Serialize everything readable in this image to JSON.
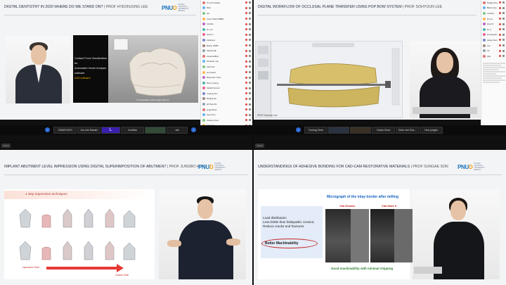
{
  "q1": {
    "title": "DIGITAL DENTISTRY IN 2020 WHERE DO WE STAND ON?",
    "prof": "| PROF HYEONJUNG LEE",
    "video_text": [
      "Contact Force Visualization for",
      "Automated Vector Analysis",
      "software",
      "ASA software"
    ],
    "video_caption": "In Cooperation with Imagen Mo Co.",
    "participants": [
      "7826871870",
      "Jun-ichi Sasaki",
      "L",
      "Amritha",
      "",
      "ofa"
    ],
    "chat_users": [
      "Jun-ichi Sasaki",
      "iPad",
      "ofa",
      "Kunio Tahan MBBS",
      "Amritha",
      "Dr. Lim",
      "HA Kim",
      "Fabieleus",
      "Bodou 35056",
      "Sebell Falk",
      "Amelie Eilbert",
      "Kimberlin Joe",
      "CHG Kim",
      "pou bassit",
      "Mokonson Chen",
      "Rami Lorieng",
      "Sebell Kamouc",
      "Youjung Kim",
      "Mingha bia",
      "Eli Tane Mo",
      "jungyi Brow",
      "Seoul Tan",
      "Suhang Chen",
      "Carmela",
      "YIlen Jun",
      "asa"
    ]
  },
  "q2": {
    "title": "DIGITAL WORKFLOW OF OCCLUSAL PLANE TRANSFER USING POP BOW SYSTEM",
    "prof": "| PROF SOHYOUN LEE",
    "video_caption": "PROF Sohyoun Lee",
    "participants": [
      "Yuming Chen",
      "",
      "",
      "Yohan Choe",
      "Chen wei Cha...",
      "Hur! jungbo"
    ],
    "chat_users": [
      "Mingjiu Ding",
      "Bianco lipo",
      "Amritha",
      "Dr.Lim",
      "lang 15",
      "Dr. A",
      "kumeleoal Hesti",
      "parag chemb",
      "ooh",
      "Aa",
      "Abd"
    ]
  },
  "q3": {
    "title": "IMPLANT ABUTMENT LEVEL IMPRESSION USING DIGITAL SUPERIMPOSITION OF ABUTMENT",
    "prof": "| PROF JUNGBO HUH",
    "slide_heading": "1 step Impression techniques",
    "left_label": "Impression Shell",
    "right_label": "Custom Shell",
    "top_status": "1 in 1"
  },
  "q4": {
    "title": "UNDERSTANDINGS OF ADHESIVE BONDING FOR CAD-CAM RESTORATIVE MATERIALS",
    "prof": "| PROF SUNGAE SON",
    "bullets": [
      "Load distribution",
      "Less brittle than feldspathic ceramic",
      "Reduce cracks and fractures"
    ],
    "highlight": "Better Machinability",
    "micro_title": "Micrograph of the inlay border after milling",
    "img1_label": "Vita Enamic",
    "img2_label": "Vita Mark II",
    "bottom_caption": "Good machinability with minimal chipping",
    "top_status": "1 in 1"
  },
  "logo": {
    "mark": "PNUD",
    "sub": "PUSAN NATIONAL UNIVERSITY DENTAL"
  },
  "colors": {
    "brand_blue": "#1b75bc",
    "brand_orange": "#f4a11a",
    "accent_red": "#c0392b",
    "highlight_blue": "#1565c0",
    "good_green": "#2e7d32"
  }
}
